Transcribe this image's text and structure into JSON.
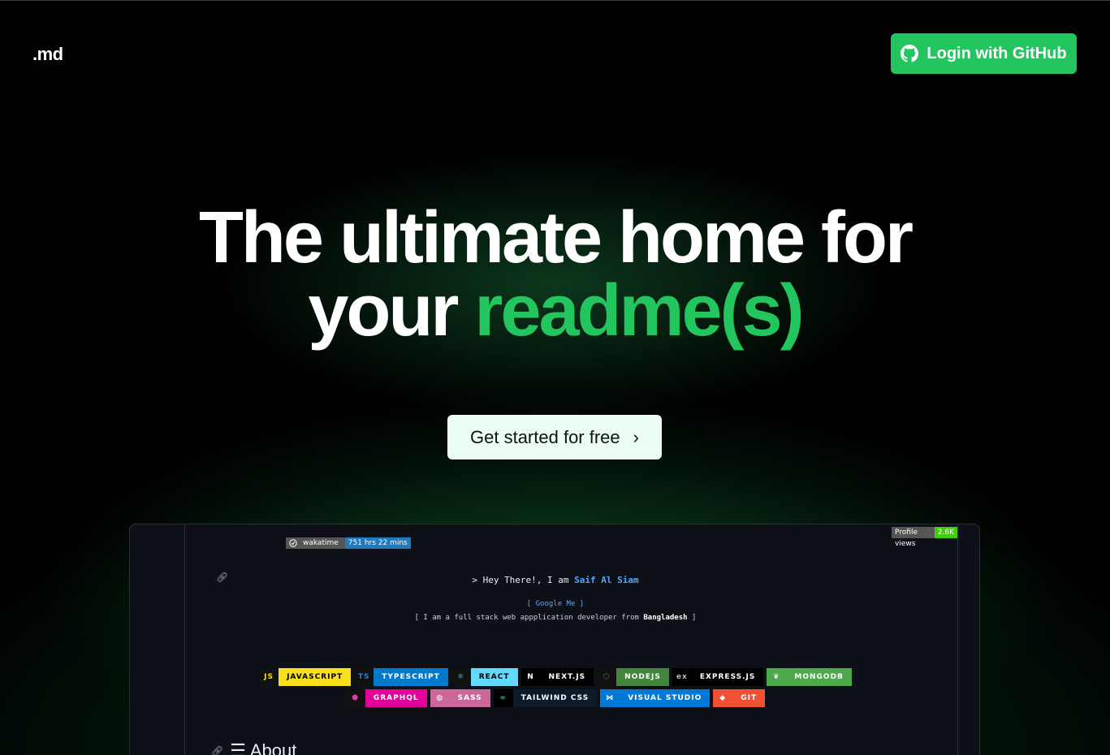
{
  "header": {
    "logo": ".md",
    "login_label": "Login with GitHub"
  },
  "hero": {
    "line1": "The ultimate home for",
    "line2_plain": "your ",
    "line2_accent": "readme(s)"
  },
  "cta": {
    "label": "Get started for free",
    "chevron": "›"
  },
  "preview": {
    "wakatime_label": "wakatime",
    "wakatime_value": "751 hrs 22 mins",
    "views_label": "Profile views",
    "views_value": "2.6K",
    "hey_prefix": "> Hey There!, I am ",
    "hey_name": "Saif Al Siam",
    "google": "[ Google Me ]",
    "desc_prefix": "[ I am a full stack web appplication developer from ",
    "desc_bold": "Bangladesh",
    "desc_suffix": " ]",
    "about_title": "☰ About",
    "techs": [
      {
        "label": "JAVASCRIPT",
        "icon": "JS",
        "icon_bg": "#111",
        "icon_color": "#f7df1e",
        "bg": "#f7df1e",
        "color": "#000"
      },
      {
        "label": "TYPESCRIPT",
        "icon": "TS",
        "icon_bg": "#111",
        "icon_color": "#3178c6",
        "bg": "#007acc",
        "color": "#fff"
      },
      {
        "label": "REACT",
        "icon": "⚛",
        "icon_bg": "#111",
        "icon_color": "#61dafb",
        "bg": "#61dafb",
        "color": "#000"
      },
      {
        "label": "NEXT.JS",
        "icon": "N",
        "icon_bg": "#000",
        "icon_color": "#fff",
        "bg": "#000",
        "color": "#fff"
      },
      {
        "label": "NODEJS",
        "icon": "⬡",
        "icon_bg": "#111",
        "icon_color": "#43853d",
        "bg": "#43853d",
        "color": "#fff"
      },
      {
        "label": "EXPRESS.JS",
        "icon": "ex",
        "icon_bg": "#000",
        "icon_color": "#bbb",
        "bg": "#000",
        "color": "#fff"
      },
      {
        "label": "MONGODB",
        "icon": "❦",
        "icon_bg": "#4ea94b",
        "icon_color": "#fff",
        "bg": "#4ea94b",
        "color": "#fff"
      },
      {
        "label": "GRAPHQL",
        "icon": "⬢",
        "icon_bg": "#111",
        "icon_color": "#e535ab",
        "bg": "#e10098",
        "color": "#fff"
      },
      {
        "label": "SASS",
        "icon": "◍",
        "icon_bg": "#cd6799",
        "icon_color": "#fff",
        "bg": "#cd6799",
        "color": "#fff"
      },
      {
        "label": "TAILWIND CSS",
        "icon": "≈",
        "icon_bg": "#000",
        "icon_color": "#38b2ac",
        "bg": "#0b1b2b",
        "color": "#fff"
      },
      {
        "label": "VISUAL STUDIO",
        "icon": "⋈",
        "icon_bg": "#0078d7",
        "icon_color": "#fff",
        "bg": "#0078d7",
        "color": "#fff"
      },
      {
        "label": "GIT",
        "icon": "◆",
        "icon_bg": "#f05033",
        "icon_color": "#fff",
        "bg": "#f05033",
        "color": "#fff"
      }
    ]
  },
  "colors": {
    "accent": "#22c55e",
    "background": "#000000",
    "cta_bg": "#ecfdf3"
  },
  "icons": {
    "github": "github-icon",
    "link": "link-icon",
    "clock": "clock-icon"
  }
}
